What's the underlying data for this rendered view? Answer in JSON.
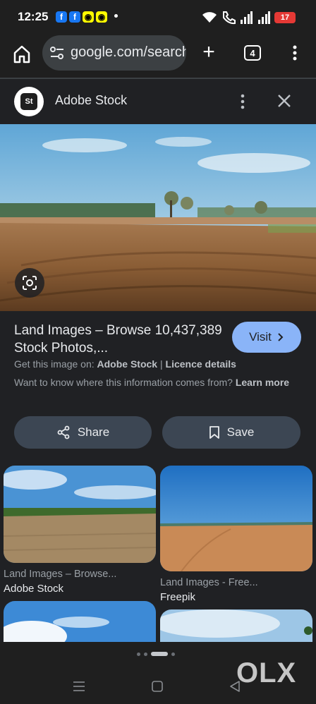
{
  "status_bar": {
    "time": "12:25",
    "battery": "17",
    "notifications": [
      "facebook-icon",
      "facebook-icon",
      "snapchat-icon",
      "snapchat-icon"
    ]
  },
  "toolbar": {
    "url": "google.com/search",
    "tab_count": "4"
  },
  "panel": {
    "source_name": "Adobe Stock",
    "logo_text": "St",
    "result_title": "Land Images – Browse 10,437,389 Stock Photos,...",
    "visit_label": "Visit",
    "get_image_prefix": "Get this image on:",
    "get_image_source": "Adobe Stock",
    "get_image_sep": "|",
    "licence_details": "Licence details",
    "info_question": "Want to know where this information comes from?",
    "learn_more": "Learn more",
    "share_label": "Share",
    "save_label": "Save"
  },
  "related": [
    {
      "title": "Land Images – Browse...",
      "source": "Adobe Stock"
    },
    {
      "title": "Land Images - Free...",
      "source": "Freepik"
    }
  ],
  "branding": {
    "watermark": "OLX"
  },
  "colors": {
    "accent": "#8ab4f8",
    "background": "#202124",
    "pill_button": "#3c4653",
    "battery": "#e53935"
  }
}
